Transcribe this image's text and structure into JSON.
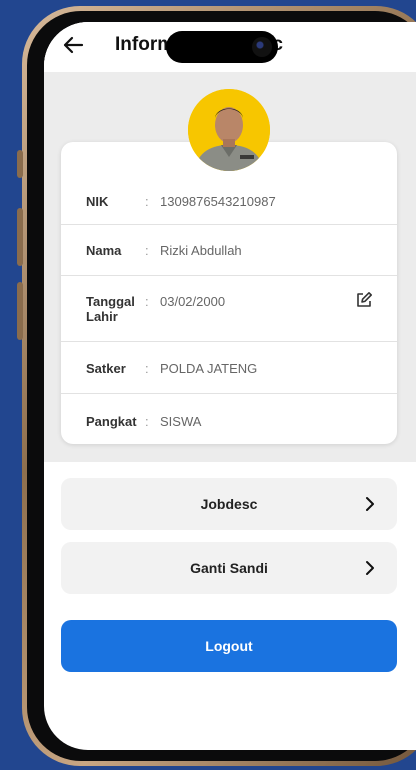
{
  "header": {
    "title": "Informasi Jobdesc",
    "back_icon": "arrow-left-icon"
  },
  "profile": {
    "avatar_icon": "profile-photo",
    "rows": [
      {
        "label": "NIK",
        "value": "1309876543210987"
      },
      {
        "label": "Nama",
        "value": "Rizki Abdullah"
      },
      {
        "label": "Tanggal Lahir",
        "value": "03/02/2000",
        "action_icon": "edit-icon"
      },
      {
        "label": "Satker",
        "value": "POLDA JATENG"
      },
      {
        "label": "Pangkat",
        "value": "SISWA"
      }
    ],
    "separator": ":"
  },
  "menu": {
    "items": [
      {
        "label": "Jobdesc",
        "icon": "chevron-right-icon"
      },
      {
        "label": "Ganti Sandi",
        "icon": "chevron-right-icon"
      }
    ],
    "logout_label": "Logout"
  },
  "colors": {
    "background": "#22468f",
    "primary": "#1a73e0",
    "avatar_bg": "#f7c600"
  }
}
